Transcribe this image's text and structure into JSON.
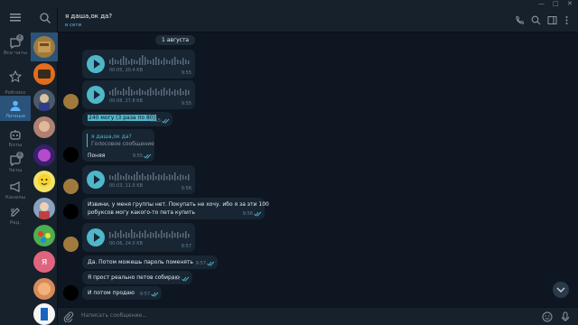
{
  "folders": [
    {
      "label": "Все чаты",
      "badge": "6",
      "icon": "chats-icon"
    },
    {
      "label": "Роблокс\nФан",
      "badge": "",
      "icon": "star-icon"
    },
    {
      "label": "Личные",
      "badge": "",
      "icon": "person-icon",
      "active": true
    },
    {
      "label": "Боты",
      "badge": "",
      "icon": "bot-icon"
    },
    {
      "label": "Чаты",
      "badge": "6",
      "icon": "group-icon"
    },
    {
      "label": "Каналы",
      "badge": "",
      "icon": "channel-icon"
    },
    {
      "label": "Ред.",
      "badge": "",
      "icon": "edit-icon"
    }
  ],
  "header": {
    "title": "я даша,ок да?",
    "status": "в сети"
  },
  "date_label": "1 августа",
  "messages": {
    "v1": {
      "meta": "00:05, 20.4 KB",
      "time": "9:55"
    },
    "v2": {
      "meta": "00:08, 27.8 KB",
      "time": "9:55"
    },
    "t1": {
      "text": "240 могу (3 раза по 80)",
      "time": "9:55"
    },
    "q1": {
      "reply_name": "я даша,ок да?",
      "reply_text": "Голосовое сообщение",
      "text": "Поняя",
      "time": "9:55"
    },
    "v3": {
      "meta": "00:03, 11.0 KB",
      "time": "9:56"
    },
    "t2": {
      "line1": "Извини, у меня группы нет. Покупать не хочу. ибо я за эти 100",
      "line2": "робуксов могу какого-то пета купить",
      "time": "9:56"
    },
    "v4": {
      "meta": "00:06, 24.0 KB",
      "time": "9:57"
    },
    "t3": {
      "text": "Да. Потом можешь пароль поменять",
      "time": "9:57"
    },
    "t4": {
      "text": "Я прост реально петов собираю",
      "time": "9:57"
    },
    "t5": {
      "text": "И потом продаю",
      "time": "9:57"
    }
  },
  "composer": {
    "placeholder": "Написать сообщение..."
  },
  "colors": {
    "accent": "#4fb7c9",
    "bubble": "#182533",
    "bg": "#0e1621",
    "panel": "#17212b",
    "active_folder": "#2b5278"
  }
}
